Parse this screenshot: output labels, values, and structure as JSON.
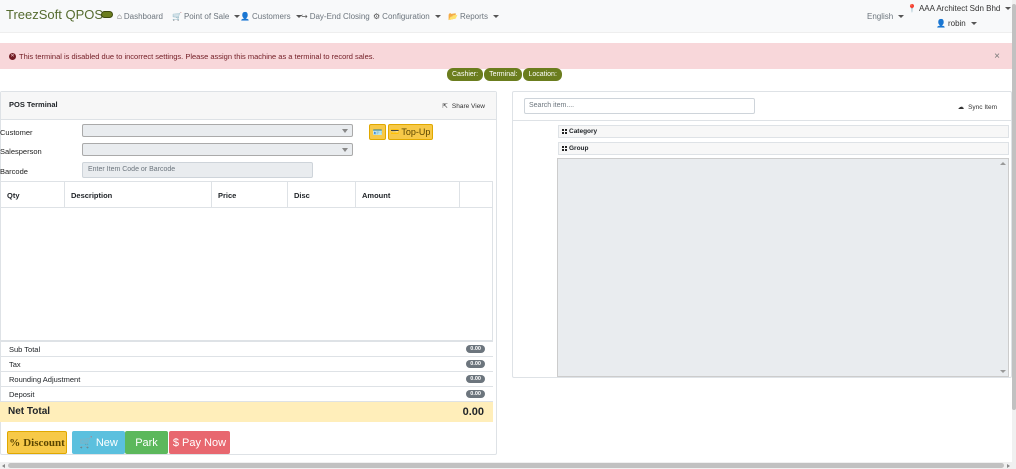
{
  "navbar": {
    "brand": "TreezSoft QPOS",
    "items": [
      {
        "label": "Dashboard",
        "icon": "home-icon",
        "glyph": "⌂"
      },
      {
        "label": "Point of Sale",
        "icon": "cart-icon",
        "glyph": "🛒"
      },
      {
        "label": "Customers",
        "icon": "users-icon",
        "glyph": "👤"
      },
      {
        "label": "Day-End Closing",
        "icon": "share-icon",
        "glyph": "↪"
      },
      {
        "label": "Configuration",
        "icon": "gear-icon",
        "glyph": "⚙"
      },
      {
        "label": "Reports",
        "icon": "folder-icon",
        "glyph": "📂"
      }
    ],
    "language": "English",
    "company": "AAA Architect Sdn Bhd",
    "user": "robin"
  },
  "alert": {
    "message": "This terminal is disabled due to incorrect settings. Please assign this machine as a terminal to record sales.",
    "close": "×"
  },
  "info_badges": [
    "Cashier:",
    "Terminal:",
    "Location:"
  ],
  "pos": {
    "title": "POS Terminal",
    "share_view": "Share View",
    "customer_label": "Customer",
    "salesperson_label": "Salesperson",
    "barcode_label": "Barcode",
    "barcode_placeholder": "Enter Item Code or Barcode",
    "topup_label": "Top-Up",
    "columns": [
      "Qty",
      "Description",
      "Price",
      "Disc",
      "Amount"
    ],
    "summary": [
      {
        "label": "Sub Total",
        "value": "0.00"
      },
      {
        "label": "Tax",
        "value": "0.00"
      },
      {
        "label": "Rounding Adjustment",
        "value": "0.00"
      },
      {
        "label": "Deposit",
        "value": "0.00"
      }
    ],
    "net_total_label": "Net Total",
    "net_total_value": "0.00",
    "buttons": {
      "discount": "Discount",
      "new": "New",
      "park": "Park",
      "pay_now": "Pay Now"
    }
  },
  "items_panel": {
    "search_placeholder": "Search item....",
    "sync_label": "Sync Item",
    "category_label": "Category",
    "group_label": "Group"
  },
  "colors": {
    "brand": "#556b2f",
    "badge": "#6b7d1e",
    "alert_bg": "#f8d7da",
    "net_total_bg": "#ffeeba",
    "discount": "#f7c948",
    "new": "#5bc0de",
    "park": "#5cb85c",
    "pay_now": "#e8676f"
  }
}
